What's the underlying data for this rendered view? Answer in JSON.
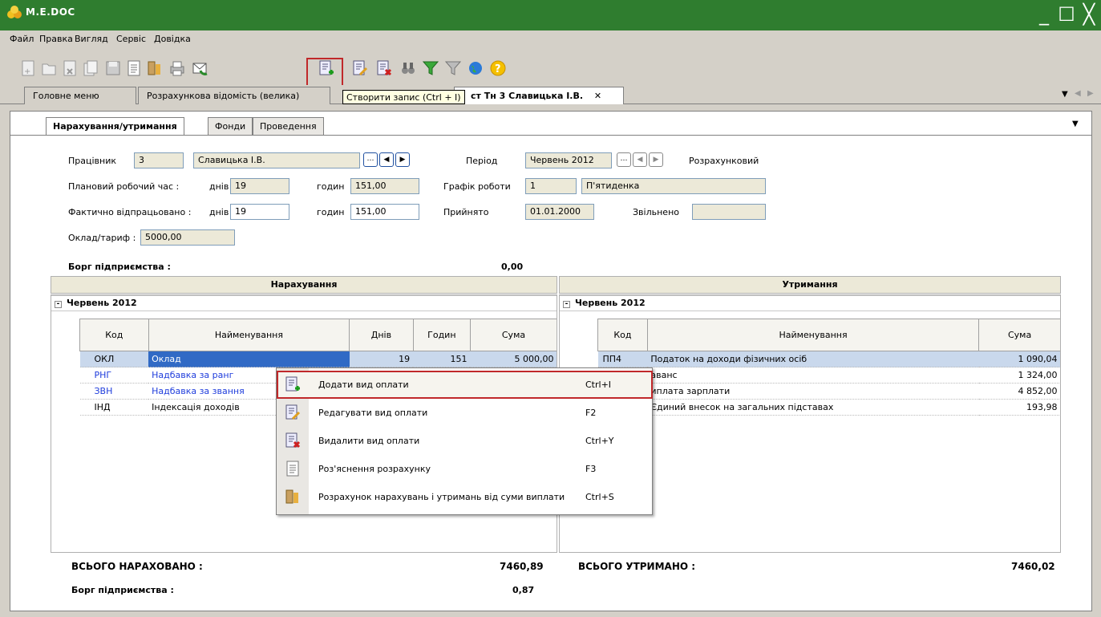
{
  "window": {
    "title": "M.E.DOC",
    "minimize": "_",
    "maximize": "☐",
    "close": "╳"
  },
  "menu": [
    "Файл",
    "Правка",
    "Вигляд",
    "Сервіс",
    "Довідка"
  ],
  "tooltip": "Створити запис (Ctrl + I)",
  "doc_tabs": {
    "main": "Головне меню",
    "report": "Розрахункова відомість (велика)",
    "active": "ст Тн 3 Славицька І.В.",
    "close": "✕"
  },
  "subtabs": [
    "Нарахування/утримання",
    "Фонди",
    "Проведення"
  ],
  "form": {
    "employee_label": "Працівник",
    "employee_id": "3",
    "employee_name": "Славицька І.В.",
    "period_label": "Період",
    "period_value": "Червень 2012",
    "period_type": "Розрахунковий",
    "planned_label": "Плановий робочий час :",
    "days_label": "днів",
    "hours_label": "годин",
    "planned_days": "19",
    "planned_hours": "151,00",
    "schedule_label": "Графік роботи",
    "schedule_id": "1",
    "schedule_name": "П'ятиденка",
    "actual_label": "Фактично відпрацьовано :",
    "actual_days": "19",
    "actual_hours": "151,00",
    "hired_label": "Прийнято",
    "hired_date": "01.01.2000",
    "fired_label": "Звільнено",
    "fired_date": "",
    "salary_label": "Оклад/тариф :",
    "salary_value": "5000,00",
    "debt_label": "Борг підприємства :",
    "debt_value": "0,00"
  },
  "accruals": {
    "header": "Нарахування",
    "group": "Червень 2012",
    "columns": [
      "Код",
      "Найменування",
      "Днів",
      "Годин",
      "Сума"
    ],
    "rows": [
      {
        "code": "ОКЛ",
        "name": "Оклад",
        "days": "19",
        "hours": "151",
        "sum": "5 000,00"
      },
      {
        "code": "РНГ",
        "name": "Надбавка за ранг",
        "days": "",
        "hours": "",
        "sum": ""
      },
      {
        "code": "ЗВН",
        "name": "Надбавка за звання",
        "days": "",
        "hours": "",
        "sum": ""
      },
      {
        "code": "ІНД",
        "name": "Індексація доходів",
        "days": "",
        "hours": "",
        "sum": ""
      }
    ],
    "total_label": "ВСЬОГО НАРАХОВАНО :",
    "total_value": "7460,89",
    "debt_label": "Борг підприємства :",
    "debt_value": "0,87"
  },
  "deductions": {
    "header": "Утримання",
    "group": "Червень 2012",
    "columns": [
      "Код",
      "Найменування",
      "Сума"
    ],
    "rows": [
      {
        "code": "ПП4",
        "name": "Податок на доходи фізичних осіб",
        "sum": "1 090,04"
      },
      {
        "code": "",
        "name": "аванс",
        "sum": "1 324,00"
      },
      {
        "code": "",
        "name": "иплата зарплати",
        "sum": "4 852,00"
      },
      {
        "code": "",
        "name": "Єдиний внесок на загальних підставах",
        "sum": "193,98"
      }
    ],
    "total_label": "ВСЬОГО УТРИМАНО :",
    "total_value": "7460,02"
  },
  "context_menu": [
    {
      "label": "Додати вид оплати",
      "shortcut": "Ctrl+I",
      "icon": "add-record-icon"
    },
    {
      "label": "Редагувати вид оплати",
      "shortcut": "F2",
      "icon": "edit-record-icon"
    },
    {
      "label": "Видалити вид оплати",
      "shortcut": "Ctrl+Y",
      "icon": "delete-record-icon"
    },
    {
      "label": "Роз'яснення розрахунку",
      "shortcut": "F3",
      "icon": "document-icon"
    },
    {
      "label": "Розрахунок нарахувань і утримань від суми виплати",
      "shortcut": "Ctrl+S",
      "icon": "calculator-icon"
    }
  ],
  "colors": {
    "titlebar": "#2f7d2f",
    "highlight": "#c0282a",
    "selection": "#316ac5"
  }
}
